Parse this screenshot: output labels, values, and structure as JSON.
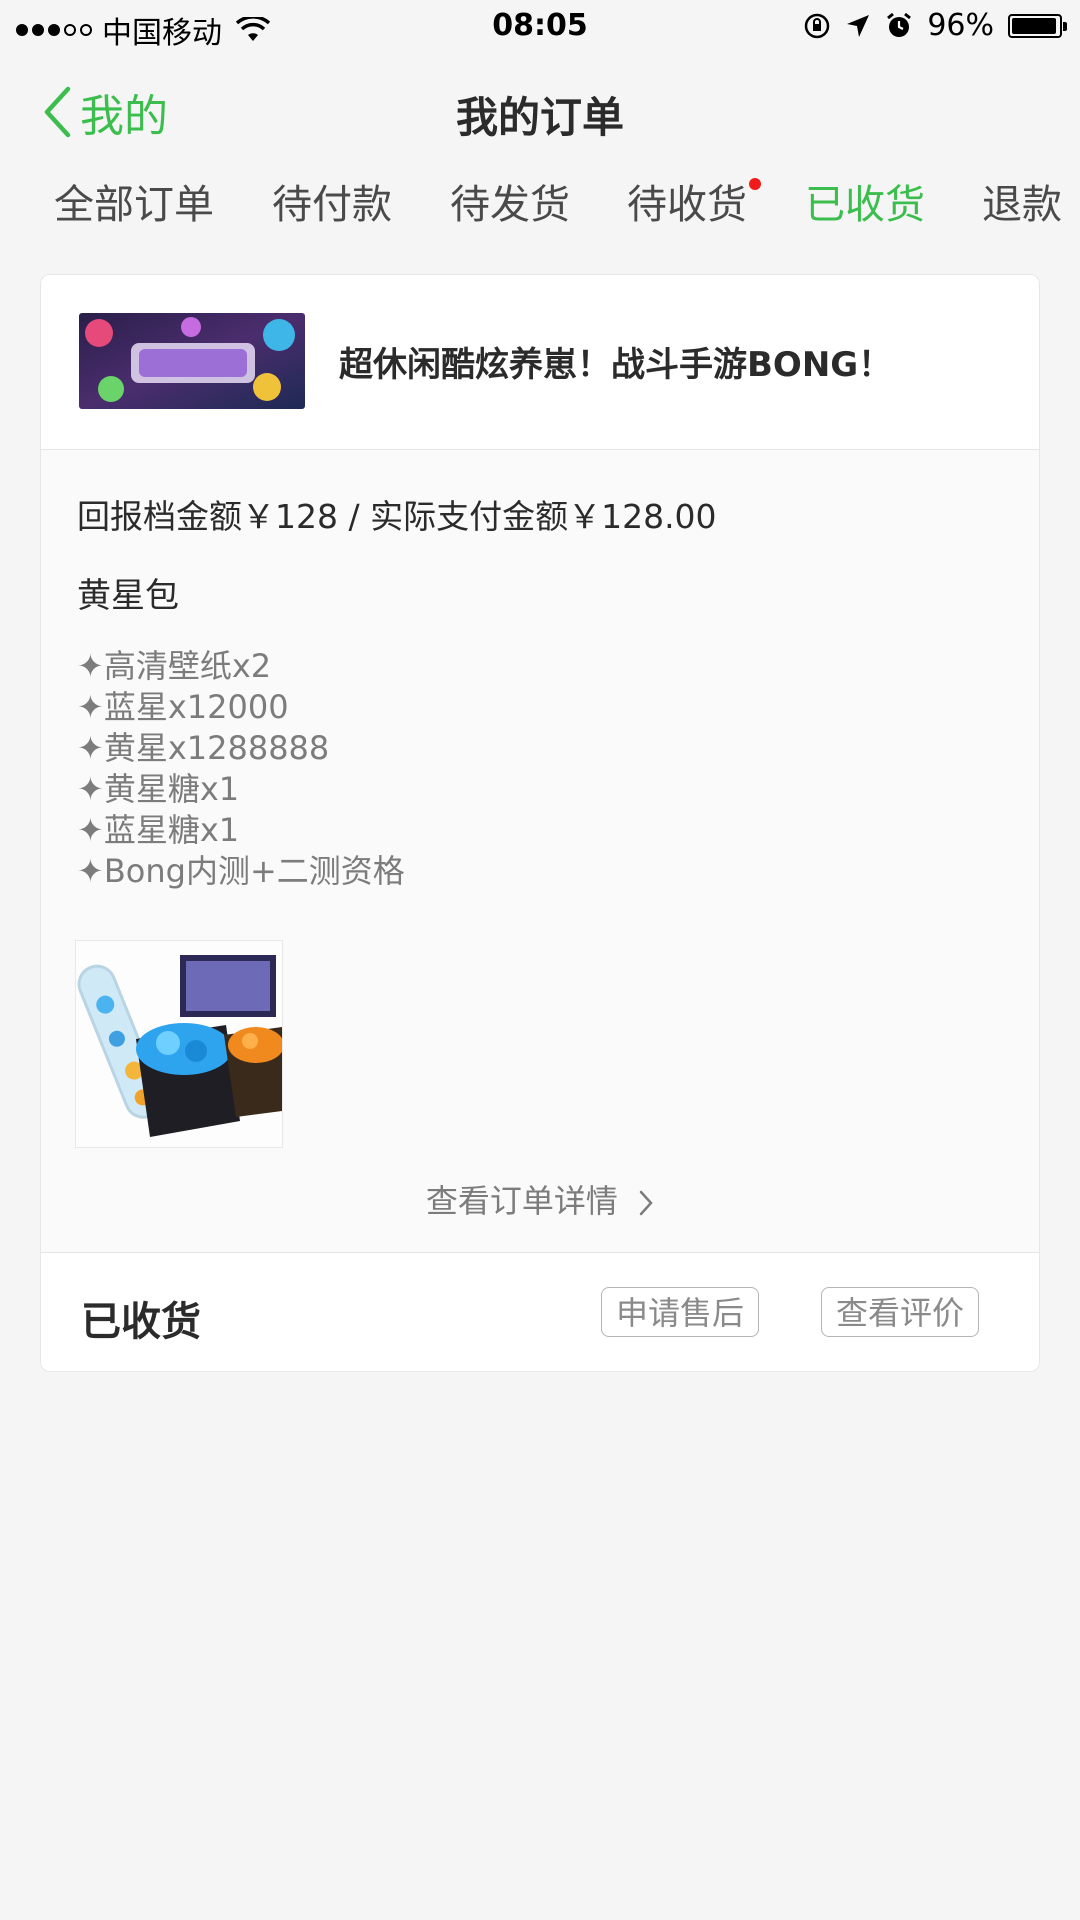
{
  "status_bar": {
    "carrier": "中国移动",
    "time": "08:05",
    "battery": "96%",
    "battery_level": 0.96
  },
  "nav": {
    "back_label": "我的",
    "title": "我的订单"
  },
  "tabs": [
    {
      "label": "全部订单"
    },
    {
      "label": "待付款"
    },
    {
      "label": "待发货"
    },
    {
      "label": "待收货"
    },
    {
      "label": "已收货"
    },
    {
      "label": "退款"
    }
  ],
  "order": {
    "game_title": "超休闲酷炫养崽！战斗手游BONG！",
    "amount_text": "回报档金额￥128 / 实际支付金额￥128.00",
    "pack_name": "黄星包",
    "items": [
      "✦高清壁纸x2",
      "✦蓝星x12000",
      "✦黄星x1288888",
      "✦黄星糖x1",
      "✦蓝星糖x1",
      "✦Bong内测+二测资格"
    ],
    "detail_link": "查看订单详情",
    "status": "已收货",
    "after_sale_button": "申请售后",
    "review_button": "查看评价"
  },
  "colors": {
    "accent": "#3cbe4e",
    "badge": "#f21b1b"
  }
}
